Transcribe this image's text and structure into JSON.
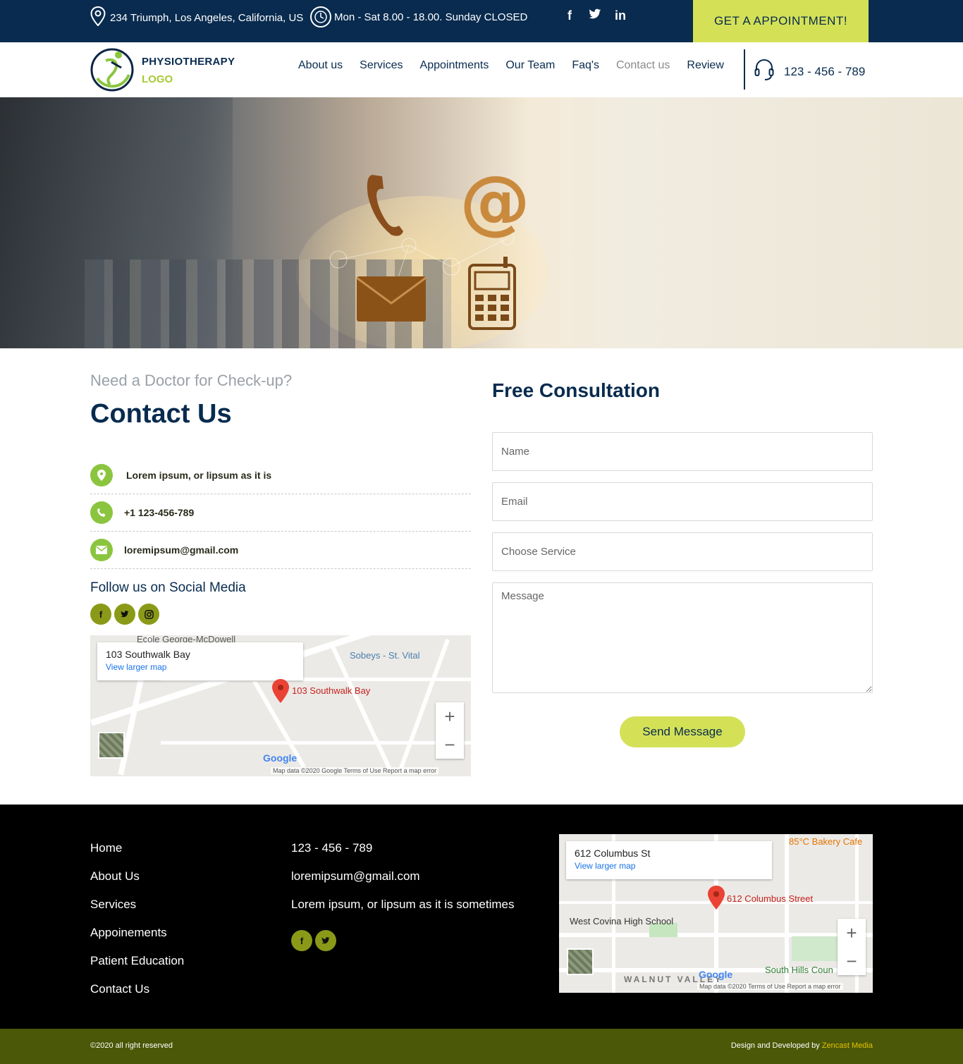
{
  "topbar": {
    "address": "234 Triumph, Los Angeles, California, US",
    "hours": "Mon - Sat 8.00 - 18.00. Sunday CLOSED",
    "social": [
      "facebook-icon",
      "twitter-icon",
      "linkedin-icon"
    ],
    "appointment_button": "GET A APPOINTMENT!"
  },
  "header": {
    "logo_line1": "PHYSIOTHERAPY",
    "logo_line2": "LOGO",
    "nav": [
      "About us",
      "Services",
      "Appointments",
      "Our Team",
      "Faq's",
      "Contact us",
      "Review"
    ],
    "active_nav": "Contact us",
    "phone": "123 - 456 - 789"
  },
  "contact": {
    "eyebrow": "Need a Doctor for Check-up?",
    "title": "Contact Us",
    "address": "Lorem ipsum, or lipsum as it is",
    "phone": "+1 123-456-789",
    "email": "loremipsum@gmail.com",
    "follow": "Follow us on Social Media"
  },
  "map1": {
    "place": "103 Southwalk Bay",
    "link": "View larger map",
    "pin_label": "103 Southwalk Bay",
    "poi1": "Sobeys - St. Vital",
    "poi2": "Ecole George-McDowell",
    "footer": "Map data ©2020 Google   Terms of Use   Report a map error"
  },
  "form": {
    "title": "Free Consultation",
    "name_placeholder": "Name",
    "email_placeholder": "Email",
    "service_placeholder": "Choose Service",
    "message_placeholder": "Message",
    "send": "Send Message"
  },
  "footer": {
    "links": [
      "Home",
      "About Us",
      "Services",
      "Appoinements",
      "Patient Education",
      "Contact Us"
    ],
    "phone": "123 - 456 - 789",
    "email": "loremipsum@gmail.com",
    "address": "Lorem ipsum, or lipsum as it is sometimes",
    "copyright": "©2020 all right reserved",
    "credit_prefix": "Design and Developed by ",
    "credit_brand": "Zencast Media"
  },
  "map2": {
    "place": "612 Columbus St",
    "link": "View larger map",
    "pin_label": "612 Columbus Street",
    "poi1": "West Covina High School",
    "poi2": "85°C Bakery Cafe",
    "poi3": "South Hills Coun",
    "area": "WALNUT VALLEY",
    "footer": "Map data ©2020   Terms of Use   Report a map error"
  },
  "colors": {
    "navy": "#082b4f",
    "accent": "#d4e157",
    "green": "#8bc53f",
    "olive": "#4a5807"
  }
}
